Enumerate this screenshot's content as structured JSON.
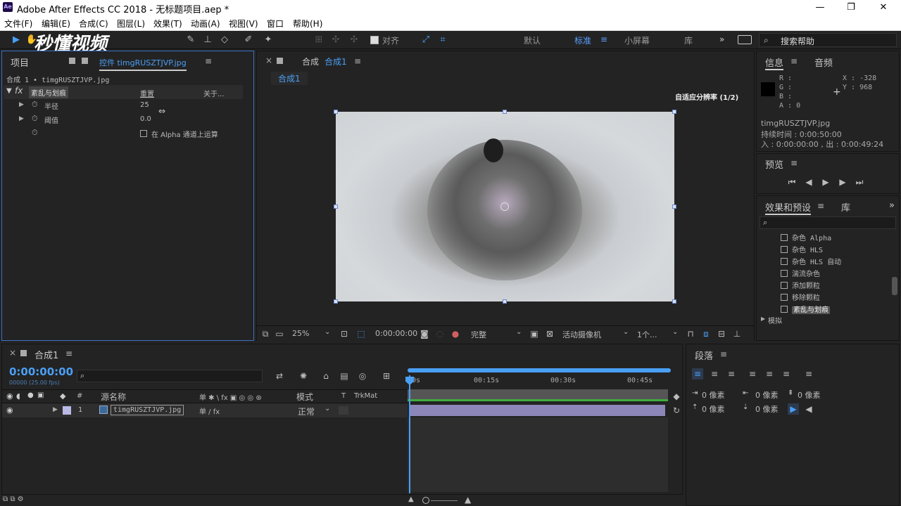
{
  "window": {
    "title": "Adobe After Effects CC 2018 - 无标题项目.aep *",
    "app_icon": "Ae",
    "minimize": "—",
    "maximize": "❐",
    "close": "✕"
  },
  "menu": [
    "文件(F)",
    "编辑(E)",
    "合成(C)",
    "图层(L)",
    "效果(T)",
    "动画(A)",
    "视图(V)",
    "窗口",
    "帮助(H)"
  ],
  "toolbar": {
    "snap_label": "对齐",
    "workspaces": [
      "默认",
      "标准",
      "小屏幕",
      "库"
    ],
    "search_placeholder": "搜索帮助",
    "watermark": "秒懂视频"
  },
  "project_panel": {
    "tab_project": "项目",
    "tab_effects_controls": "控件 timgRUSZTJVP.jpg",
    "breadcrumb": "合成 1 • timgRUSZTJVP.jpg",
    "effect_name": "紊乱与划痕",
    "reset": "重置",
    "about": "关于...",
    "params": [
      {
        "name": "半径",
        "value": "25"
      },
      {
        "name": "阈值",
        "value": "0.0"
      }
    ],
    "alpha_checkbox": "在 Alpha 通道上运算"
  },
  "comp_viewer": {
    "tab_label": "合成",
    "comp_name": "合成1",
    "sub_tab": "合成1",
    "resolution_label": "自适应分辨率 (1/2)",
    "zoom": "25%",
    "timecode": "0:00:00:00",
    "quality": "完整",
    "camera": "活动摄像机",
    "views": "1个..."
  },
  "info_panel": {
    "tab_info": "信息",
    "tab_audio": "音频",
    "r": "R :",
    "g": "G :",
    "b": "B :",
    "a": "A : 0",
    "x": "X : -328",
    "y": "Y : 968",
    "filename": "timgRUSZTJVP.jpg",
    "duration": "持续时间 : 0:00:50:00",
    "inout": "入 : 0:00:00:00 , 出 : 0:00:49:24"
  },
  "preview_panel": {
    "tab": "预览"
  },
  "effects_panel": {
    "tab": "效果和预设",
    "tab_lib": "库",
    "items": [
      "杂色 Alpha",
      "杂色 HLS",
      "杂色 HLS 自动",
      "湍流杂色",
      "添加颗粒",
      "移除颗粒",
      "紊乱与划痕"
    ],
    "group": "模拟"
  },
  "timeline": {
    "tab": "合成1",
    "timecode": "0:00:00:00",
    "fps": "00000 (25.00 fps)",
    "col_hash": "#",
    "col_source": "源名称",
    "col_mode": "模式",
    "col_t": "T",
    "col_trkmat": "TrkMat",
    "layer_index": "1",
    "layer_name": "timgRUSZTJVP.jpg",
    "layer_mode": "正常",
    "ruler": [
      "0s",
      "00:15s",
      "00:30s",
      "00:45s"
    ]
  },
  "paragraph_panel": {
    "tab": "段落",
    "indent1": "0 像素",
    "indent2": "0 像素",
    "indent3": "0 像素",
    "space1": "0 像素",
    "space2": "0 像素"
  }
}
